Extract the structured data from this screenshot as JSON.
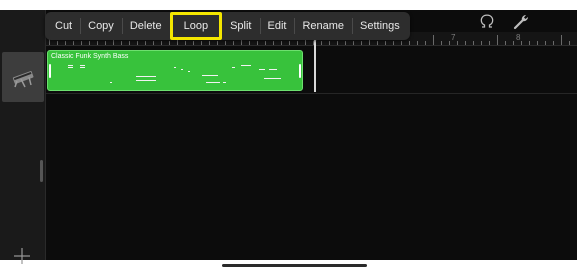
{
  "context_menu": {
    "items": [
      {
        "label": "Cut"
      },
      {
        "label": "Copy"
      },
      {
        "label": "Delete"
      },
      {
        "label": "Loop"
      },
      {
        "label": "Split"
      },
      {
        "label": "Edit"
      },
      {
        "label": "Rename"
      },
      {
        "label": "Settings"
      }
    ],
    "highlight_color": "#f4e600"
  },
  "ruler": {
    "bar_numbers": [
      "7",
      "8"
    ]
  },
  "region": {
    "name": "Classic Funk Synth Bass",
    "color": "#38c23c"
  },
  "toolbar": {
    "tuner_icon": "tuning-fork-icon",
    "settings_icon": "wrench-icon"
  },
  "track": {
    "icon": "synth-keyboard-icon"
  },
  "add_track": {
    "icon": "plus-icon"
  }
}
